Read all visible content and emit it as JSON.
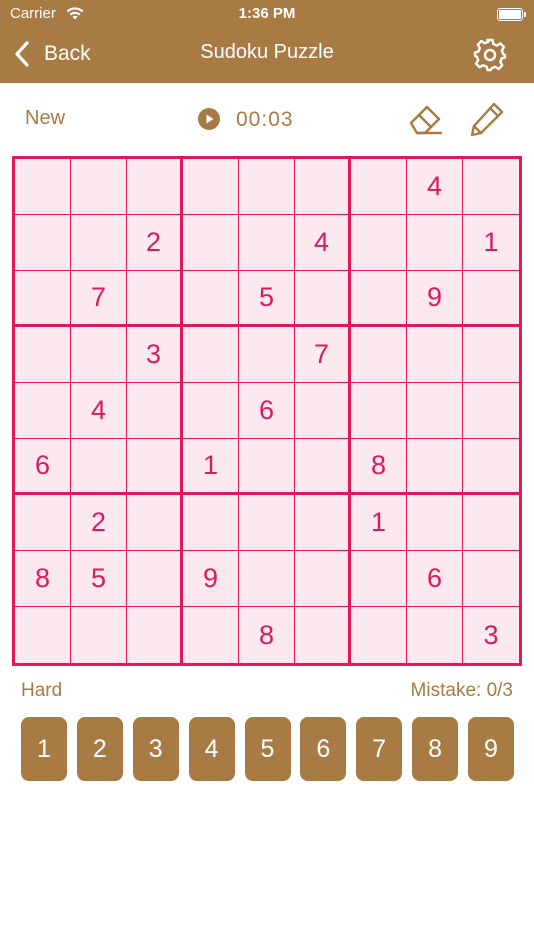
{
  "status_bar": {
    "carrier": "Carrier",
    "time": "1:36 PM"
  },
  "nav": {
    "back_label": "Back",
    "title": "Sudoku Puzzle",
    "settings_icon": "gear-icon"
  },
  "controls": {
    "new_label": "New",
    "play_icon": "play-icon",
    "timer": "00:03",
    "eraser_icon": "eraser-icon",
    "pencil_icon": "pencil-icon"
  },
  "board": [
    [
      "",
      "",
      "",
      "",
      "",
      "",
      "",
      "4",
      ""
    ],
    [
      "",
      "",
      "2",
      "",
      "",
      "4",
      "",
      "",
      "1"
    ],
    [
      "",
      "7",
      "",
      "",
      "5",
      "",
      "",
      "9",
      ""
    ],
    [
      "",
      "",
      "3",
      "",
      "",
      "7",
      "",
      "",
      ""
    ],
    [
      "",
      "4",
      "",
      "",
      "6",
      "",
      "",
      "",
      ""
    ],
    [
      "6",
      "",
      "",
      "1",
      "",
      "",
      "8",
      "",
      ""
    ],
    [
      "",
      "2",
      "",
      "",
      "",
      "",
      "1",
      "",
      ""
    ],
    [
      "8",
      "5",
      "",
      "9",
      "",
      "",
      "",
      "6",
      ""
    ],
    [
      "",
      "",
      "",
      "",
      "8",
      "",
      "",
      "",
      "3"
    ]
  ],
  "footer": {
    "difficulty": "Hard",
    "mistake_label": "Mistake:",
    "mistake_count": "0/3"
  },
  "numpad": [
    "1",
    "2",
    "3",
    "4",
    "5",
    "6",
    "7",
    "8",
    "9"
  ],
  "colors": {
    "brand": "#a87a44",
    "grid": "#e0185f",
    "cell_bg": "#fce8ef",
    "digit": "#d81b60"
  }
}
